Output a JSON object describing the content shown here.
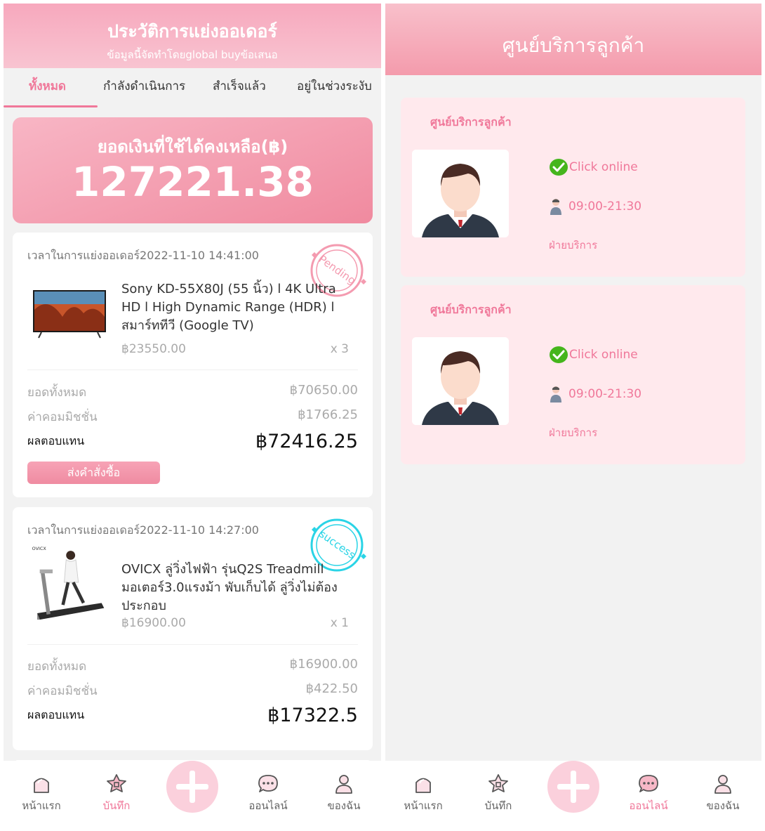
{
  "left": {
    "header": {
      "title": "ประวัติการแย่งออเดอร์",
      "subtitle": "ข้อมูลนี้จัดทำโดยglobal buyข้อเสนอ"
    },
    "tabs": [
      {
        "label": "ทั้งหมด"
      },
      {
        "label": "กำลังดำเนินการ"
      },
      {
        "label": "สำเร็จแล้ว"
      },
      {
        "label": "อยู่ในช่วงระงับ"
      }
    ],
    "balance": {
      "label": "ยอดเงินที่ใช้ได้คงเหลือ(฿)",
      "amount": "127221.38"
    },
    "orders": [
      {
        "time": "เวลาในการแย่งออเดอร์2022-11-10 14:41:00",
        "stamp": "Pending",
        "product_name": "Sony KD-55X80J (55 นิ้ว) l 4K Ultra HD l High Dynamic Range (HDR) l สมาร์ททีวี (Google TV)",
        "price": "฿23550.00",
        "qty": "x 3",
        "total_label": "ยอดทั้งหมด",
        "total_value": "฿70650.00",
        "commission_label": "ค่าคอมมิชชั่น",
        "commission_value": "฿1766.25",
        "return_label": "ผลตอบแทน",
        "return_value": "฿72416.25",
        "submit_label": "ส่งคำสั่งซื้อ"
      },
      {
        "time": "เวลาในการแย่งออเดอร์2022-11-10 14:27:00",
        "stamp": "success",
        "product_name": "OVICX ลู่วิ่งไฟฟ้า รุ่นQ2S Treadmill มอเตอร์3.0แรงม้า พับเก็บได้ ลู่วิ่งไม่ต้องประกอบ",
        "brand_mark": "OVICX",
        "price": "฿16900.00",
        "qty": "x 1",
        "total_label": "ยอดทั้งหมด",
        "total_value": "฿16900.00",
        "commission_label": "ค่าคอมมิชชั่น",
        "commission_value": "฿422.50",
        "return_label": "ผลตอบแทน",
        "return_value": "฿17322.5"
      }
    ],
    "nav": [
      {
        "label": "หน้าแรก",
        "icon": "home-icon"
      },
      {
        "label": "บันทึก",
        "icon": "record-icon"
      },
      {
        "label": "ออนไลน์",
        "icon": "chat-icon"
      },
      {
        "label": "ของฉัน",
        "icon": "user-icon"
      }
    ]
  },
  "right": {
    "header": {
      "title": "ศูนย์บริการลูกค้า"
    },
    "services": [
      {
        "title": "ศูนย์บริการลูกค้า",
        "online": "Click online",
        "hours": "09:00-21:30",
        "dept": "ฝ่ายบริการ"
      },
      {
        "title": "ศูนย์บริการลูกค้า",
        "online": "Click online",
        "hours": "09:00-21:30",
        "dept": "ฝ่ายบริการ"
      }
    ],
    "nav": [
      {
        "label": "หน้าแรก",
        "icon": "home-icon"
      },
      {
        "label": "บันทึก",
        "icon": "record-icon"
      },
      {
        "label": "ออนไลน์",
        "icon": "chat-icon"
      },
      {
        "label": "ของฉัน",
        "icon": "user-icon"
      }
    ]
  },
  "colors": {
    "accent": "#f0789a",
    "header_pink": "#f7a8bd",
    "service_bg": "#ffe9ed",
    "success_stamp": "#2ad4e6"
  }
}
